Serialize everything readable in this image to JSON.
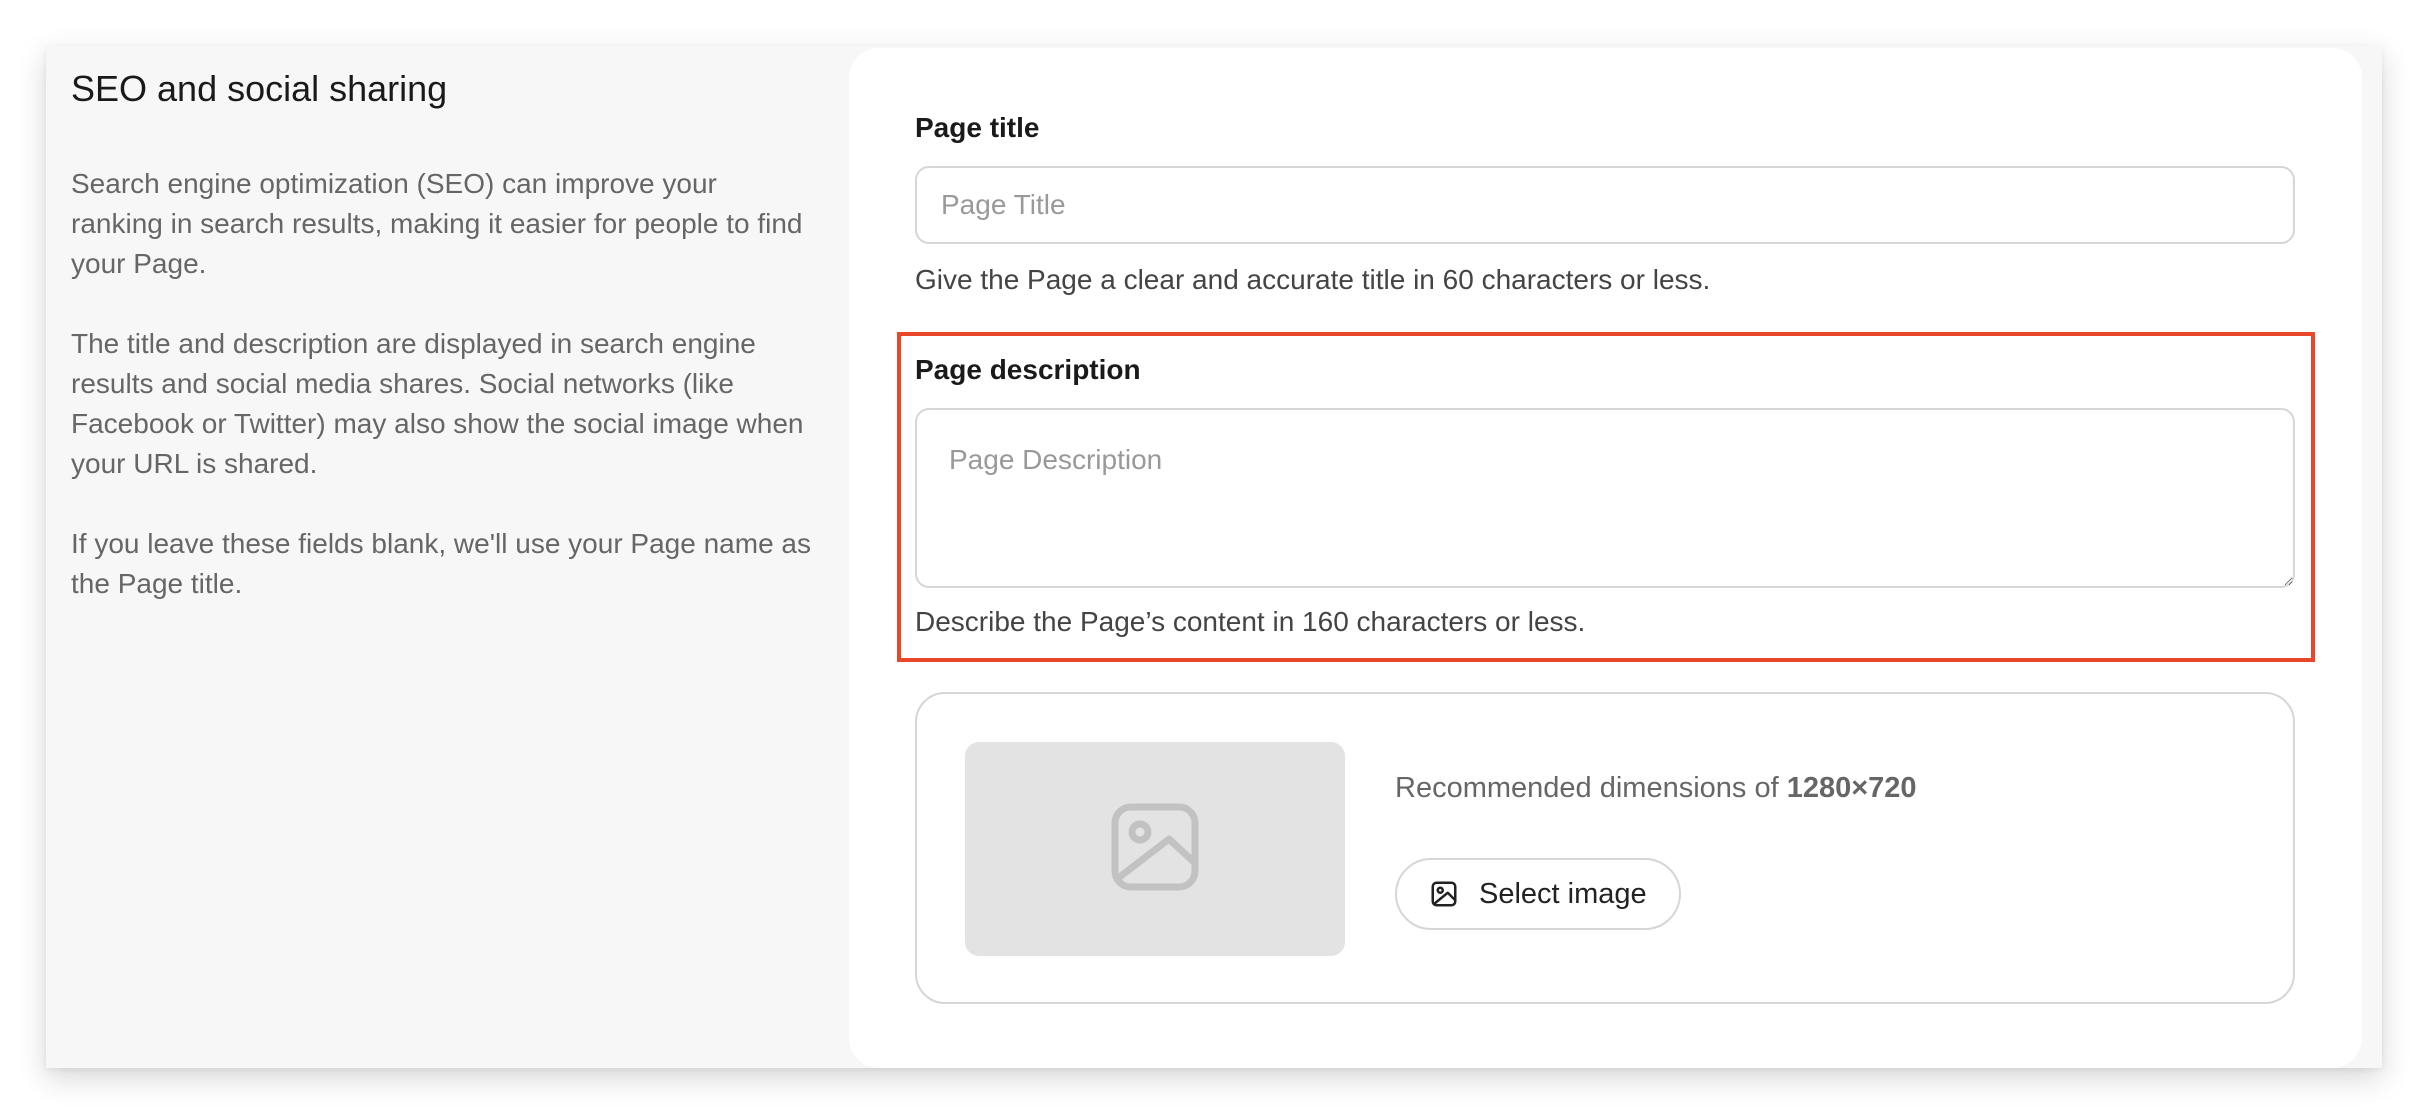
{
  "sidebar": {
    "title": "SEO and social sharing",
    "paragraphs": [
      "Search engine optimization (SEO) can improve your ranking in search results, making it easier for people to find your Page.",
      "The title and description are displayed in search engine results and social media shares. Social networks (like Facebook or Twitter) may also show the social image when your URL is shared.",
      "If you leave these fields blank, we'll use your Page name as the Page title."
    ]
  },
  "form": {
    "page_title": {
      "label": "Page title",
      "value": "",
      "placeholder": "Page Title",
      "help": "Give the Page a clear and accurate title in 60 characters or less."
    },
    "page_description": {
      "label": "Page description",
      "value": "",
      "placeholder": "Page Description",
      "help": "Describe the Page’s content in 160 characters or less."
    },
    "social_image": {
      "dimensions_prefix": "Recommended dimensions of",
      "dimensions_value": "1280×720",
      "select_label": "Select image",
      "placeholder_icon": "image-icon",
      "button_icon": "image-icon"
    }
  },
  "colors": {
    "highlight": "#e8472a",
    "card_background": "#ffffff",
    "page_background": "#f7f7f7",
    "placeholder_fill": "#e3e3e3"
  }
}
